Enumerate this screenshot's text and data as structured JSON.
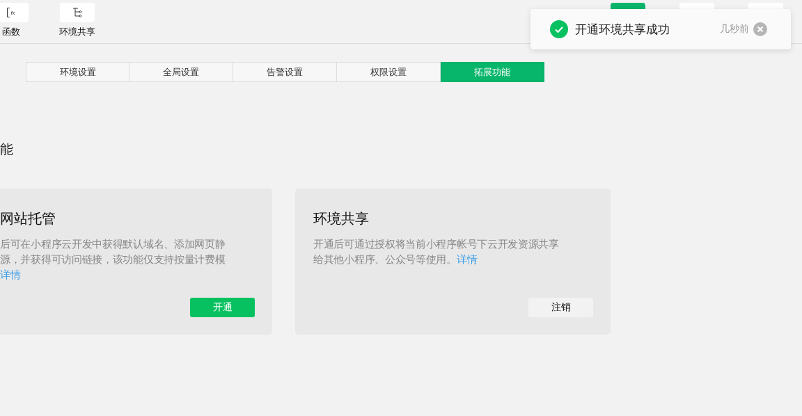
{
  "toolbar": {
    "left": [
      {
        "kind": "function",
        "glyph": "fx",
        "label": "函数"
      },
      {
        "kind": "share",
        "label": "环境共享"
      }
    ],
    "right": [
      {
        "selected": true
      },
      {
        "selected": false
      },
      {
        "selected": false
      }
    ]
  },
  "tabs": [
    {
      "label": "环境设置",
      "selected": false
    },
    {
      "label": "全局设置",
      "selected": false
    },
    {
      "label": "告警设置",
      "selected": false
    },
    {
      "label": "权限设置",
      "selected": false
    },
    {
      "label": "拓展功能",
      "selected": true
    }
  ],
  "section_title": "能",
  "cards": [
    {
      "title": "网站托管",
      "lines": [
        "后可在小程序云开发中获得默认域名、添加网页静",
        "源，并获得可访问链接，该功能仅支持按量计费模"
      ],
      "link": "详情",
      "button": {
        "label": "开通",
        "kind": "primary"
      }
    },
    {
      "title": "环境共享",
      "lines": [
        "开通后可通过授权将当前小程序帐号下云开发资源共享",
        "给其他小程序、公众号等使用。"
      ],
      "link": "详情",
      "button": {
        "label": "注销",
        "kind": "default"
      }
    }
  ],
  "toast": {
    "message": "开通环境共享成功",
    "time": "几秒前"
  }
}
